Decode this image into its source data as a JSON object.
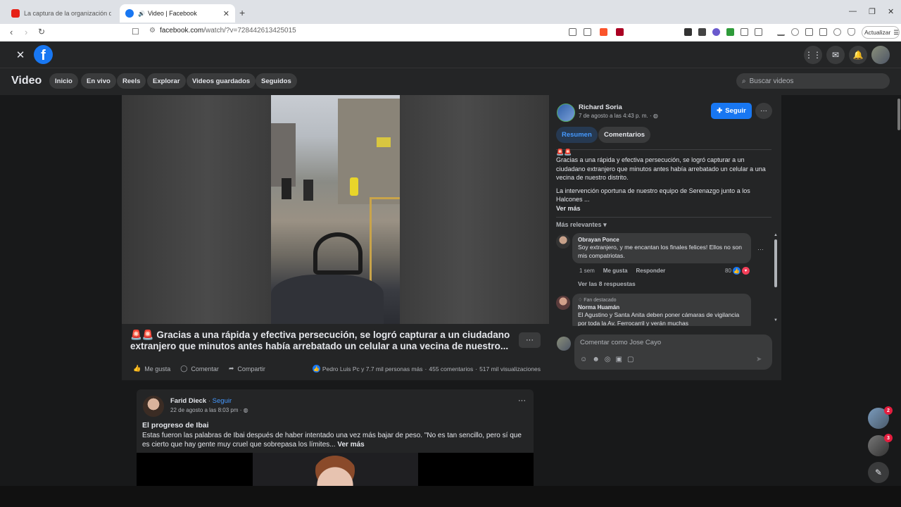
{
  "browser": {
    "tabs": [
      {
        "label": "La captura de la organización delicu"
      },
      {
        "label": "Video | Facebook"
      }
    ],
    "url_prefix": "facebook.com",
    "url_path": "/watch/?v=728442613425015",
    "update_label": "Actualizar"
  },
  "nav": {
    "title": "Video",
    "pills": [
      "Inicio",
      "En vivo",
      "Reels",
      "Explorar",
      "Videos guardados",
      "Seguidos"
    ],
    "search_placeholder": "Buscar videos"
  },
  "post": {
    "title": "🚨🚨 Gracias a una rápida y efectiva persecución, se logró capturar a un ciudadano extranjero que minutos antes había arrebatado un celular a una vecina de nuestro...",
    "actions": {
      "like": "Me gusta",
      "comment": "Comentar",
      "share": "Compartir"
    },
    "reactions": "Pedro Luis Pc y 7.7 mil personas más",
    "comments_count": "455 comentarios",
    "views": "517 mil visualizaciones"
  },
  "panel": {
    "author": "Richard Soria",
    "date": "7 de agosto a las 4:43 p. m. ·",
    "follow": "Seguir",
    "tabs": {
      "summary": "Resumen",
      "comments": "Comentarios"
    },
    "emoji": "🚨🚨",
    "desc1": "Gracias a una rápida y efectiva persecución, se logró capturar a un ciudadano extranjero que minutos antes había arrebatado un celular a una vecina de nuestro distrito.",
    "desc2": "La intervención oportuna de nuestro equipo de Serenazgo junto a los Halcones ...",
    "see_more": "Ver más",
    "sort": "Más relevantes",
    "comments": [
      {
        "name": "Obrayan Ponce",
        "text": "Soy extranjero, y me encantan los finales felices! Ellos no son mis compatriotas.",
        "time": "1 sem",
        "like": "Me gusta",
        "reply": "Responder",
        "reactions": "80",
        "replies": "Ver las 8 respuestas"
      },
      {
        "badge": "Fan destacado",
        "name": "Norma Huamán",
        "text": "El Agustino y Santa Anita deben poner cámaras de vigilancia por toda la Av. Ferrocarril y verán muchas"
      }
    ],
    "comment_placeholder": "Comentar como Jose Cayo"
  },
  "post2": {
    "author": "Farid Dieck",
    "follow": "Seguir",
    "date": "22 de agosto a las 8:03 pm ·",
    "title": "El progreso de Ibai",
    "text": "Estas fueron las palabras de Ibai después de haber intentado una vez más bajar de peso. \"No es tan sencillo, pero sí que es cierto que hay gente muy cruel que sobrepasa los límites...",
    "see_more": "Ver más"
  },
  "floating": {
    "badge1": "2",
    "badge2": "3"
  },
  "colors": {
    "accent": "#1877f2",
    "background": "#18191a",
    "surface": "#242526"
  }
}
